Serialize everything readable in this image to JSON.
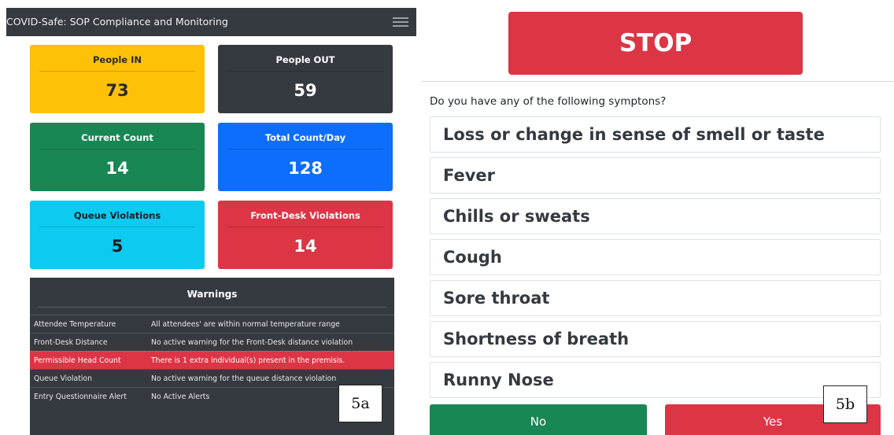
{
  "dashboard": {
    "app_title": "COVID-Safe: SOP Compliance and Monitoring",
    "cards": [
      {
        "label": "People IN",
        "value": "73",
        "bg": "#ffc107",
        "fg": "#2b2b2b"
      },
      {
        "label": "People OUT",
        "value": "59",
        "bg": "#343a40",
        "fg": "#ffffff"
      },
      {
        "label": "Current Count",
        "value": "14",
        "bg": "#198754",
        "fg": "#ffffff"
      },
      {
        "label": "Total Count/Day",
        "value": "128",
        "bg": "#0d6efd",
        "fg": "#ffffff"
      },
      {
        "label": "Queue Violations",
        "value": "5",
        "bg": "#0dcaf0",
        "fg": "#1c1c1c"
      },
      {
        "label": "Front-Desk Violations",
        "value": "14",
        "bg": "#dc3545",
        "fg": "#ffffff"
      }
    ],
    "warnings": {
      "title": "Warnings",
      "rows": [
        {
          "name": "Attendee Temperature",
          "message": "All attendees' are within normal temperature range",
          "alert": false
        },
        {
          "name": "Front-Desk Distance",
          "message": "No active warning for the Front-Desk distance violation",
          "alert": false
        },
        {
          "name": "Permissible Head Count",
          "message": "There is 1 extra individual(s) present in the premisis.",
          "alert": true
        },
        {
          "name": "Queue Violation",
          "message": "No active warning for the queue distance violation",
          "alert": false
        },
        {
          "name": "Entry Questionnaire Alert",
          "message": "No Active Alerts",
          "alert": false
        }
      ]
    },
    "figure_label": "5a"
  },
  "questionnaire": {
    "stop_label": "STOP",
    "question": "Do you have any of the following symptons?",
    "symptoms": [
      "Loss or change in sense of smell or taste",
      "Fever",
      "Chills or sweats",
      "Cough",
      "Sore throat",
      "Shortness of breath",
      "Runny Nose"
    ],
    "no_label": "No",
    "yes_label": "Yes",
    "figure_label": "5b"
  },
  "colors": {
    "danger": "#dc3545",
    "success": "#198754",
    "dark": "#343a40"
  }
}
